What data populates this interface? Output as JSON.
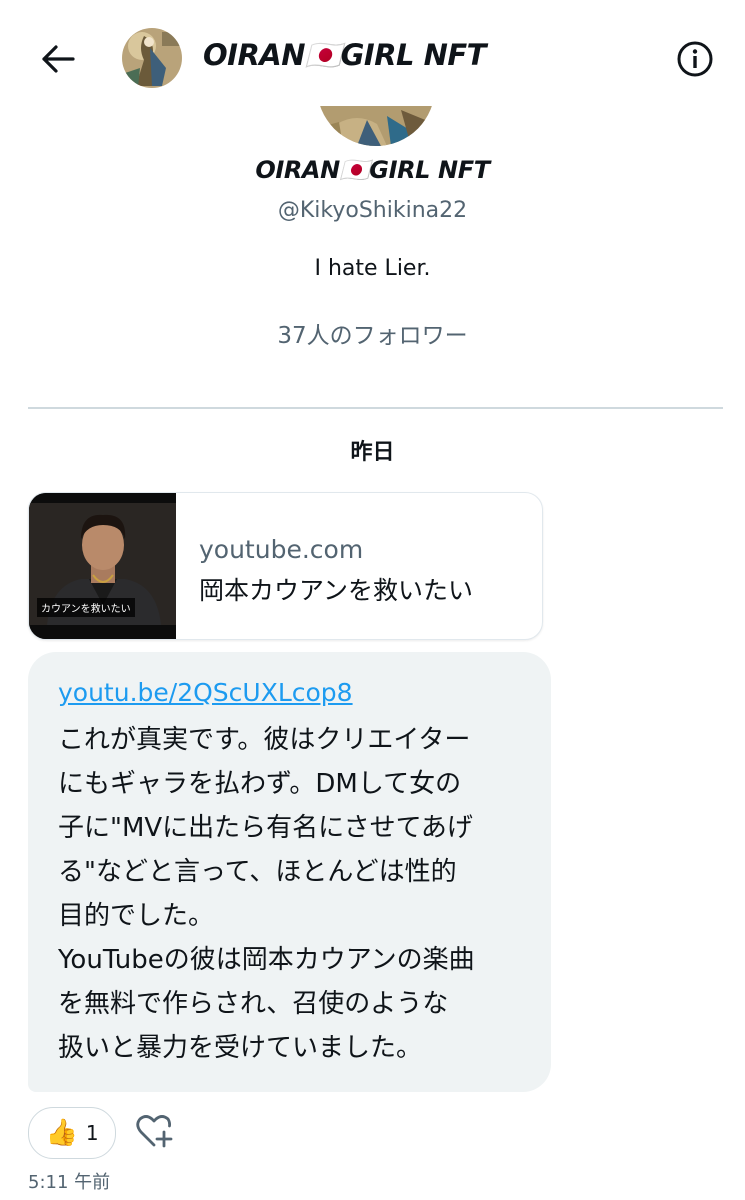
{
  "header": {
    "title": "OIRAN🇯🇵GIRL NFT",
    "back_icon": "arrow-left-icon",
    "info_icon": "info-circle-icon"
  },
  "profile": {
    "name": "OIRAN🇯🇵GIRL NFT",
    "handle": "@KikyoShikina22",
    "bio": "I hate Lier.",
    "followers": "37人のフォロワー"
  },
  "date_label": "昨日",
  "link_card": {
    "thumbnail_caption": "カウアンを救いたい",
    "domain": "youtube.com",
    "title": "岡本カウアンを救いたい"
  },
  "message": {
    "link": "youtu.be/2QScUXLcop8",
    "lines": [
      "これが真実です。彼はクリエイター",
      "にもギャラを払わず。DMして女の",
      "子に\"MVに出たら有名にさせてあげ",
      "る\"などと言って、ほとんどは性的",
      "目的でした。",
      "YouTubeの彼は岡本カウアンの楽曲",
      "を無料で作らされ、召使のような",
      "扱いと暴力を受けていました。"
    ]
  },
  "reactions": {
    "emoji": "👍",
    "count": "1",
    "add_icon": "heart-plus-icon"
  },
  "timestamp": "5:11 午前",
  "colors": {
    "accent_link": "#1d9bf0",
    "bubble_bg": "#eff3f4",
    "secondary_text": "#536471"
  }
}
